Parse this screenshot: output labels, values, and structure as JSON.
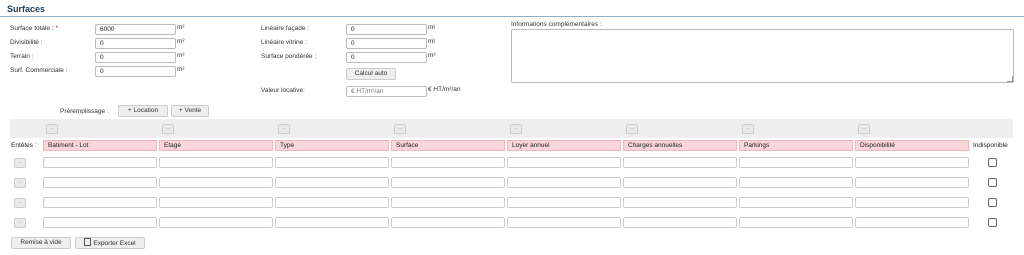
{
  "section": {
    "title": "Surfaces"
  },
  "col1": {
    "surface_totale": {
      "label": "Surface totale :",
      "required": "*",
      "value": "6000",
      "unit": "m²"
    },
    "divisibilite": {
      "label": "Divisibilité :",
      "value": "0",
      "unit": "m²"
    },
    "terrain": {
      "label": "Terrain :",
      "value": "0",
      "unit": "m²"
    },
    "surf_commerciale": {
      "label": "Surf. Commerciale :",
      "value": "0",
      "unit": "m²"
    }
  },
  "col2": {
    "lineaire_facade": {
      "label": "Linéaire façade :",
      "value": "0",
      "unit": "ml"
    },
    "lineaire_vitrine": {
      "label": "Linéaire vitrine :",
      "value": "0",
      "unit": "ml"
    },
    "surface_ponderee": {
      "label": "Surface pondérée :",
      "value": "0",
      "unit": "m²"
    },
    "calcul_auto": "Calcul auto",
    "valeur_locative": {
      "label": "Valeur locative:",
      "placeholder": "€ HT/m²/an",
      "unit": "€ HT/m²/an"
    }
  },
  "infos": {
    "label": "Informations complémentaires :"
  },
  "prefill": {
    "label": "Préremplissage :",
    "location": "+ Location",
    "vente": "+ Vente"
  },
  "table": {
    "mini_btn": "...",
    "entetes_label": "Entêtes :",
    "columns": [
      "Batiment - Lot",
      "Etage",
      "Type",
      "Surface",
      "Loyer annuel",
      "Charges annuelles",
      "Parkings",
      "Disponibilité"
    ],
    "indisponible": "Indisponible",
    "rows": 4
  },
  "actions": {
    "remise": "Remise à vide",
    "export": "Exporter Excel"
  }
}
